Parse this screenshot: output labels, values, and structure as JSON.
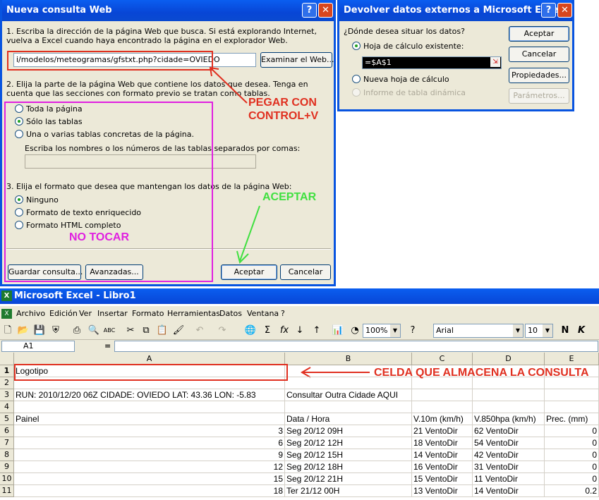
{
  "dialog1": {
    "title": "Nueva consulta Web",
    "step1": "1. Escriba la dirección de la página Web que busca. Si está explorando Internet, vuelva a Excel cuando haya encontrado la página en el explorador Web.",
    "url": "i/modelos/meteogramas/gfstxt.php?cidade=OVIEDO",
    "browse": "Examinar el Web...",
    "step2": "2. Elija la parte de la página Web que contiene los datos que desea. Tenga en cuenta que las secciones con formato previo se tratan como tablas.",
    "opt_all": "Toda la página",
    "opt_tables": "Sólo las tablas",
    "opt_some": "Una o varias tablas concretas de la página.",
    "names_label": "Escriba los nombres o los números de las tablas separados por comas:",
    "step3": "3. Elija el formato que desea que mantengan los datos de la página Web:",
    "fmt_none": "Ninguno",
    "fmt_rich": "Formato de texto enriquecido",
    "fmt_html": "Formato HTML completo",
    "save": "Guardar consulta...",
    "advanced": "Avanzadas...",
    "ok": "Aceptar",
    "cancel": "Cancelar"
  },
  "dialog2": {
    "title": "Devolver datos externos a Microsoft Excel",
    "question": "¿Dónde desea situar los datos?",
    "opt_existing": "Hoja de cálculo existente:",
    "ref": "=$A$1",
    "opt_new": "Nueva hoja de cálculo",
    "opt_pivot": "Informe de tabla dinámica",
    "ok": "Aceptar",
    "cancel": "Cancelar",
    "props": "Propiedades...",
    "params": "Parámetros..."
  },
  "annotations": {
    "paste": "PEGAR CON",
    "paste2": "CONTROL+V",
    "accept": "ACEPTAR",
    "notouch": "NO TOCAR",
    "cell": "CELDA QUE ALMACENA LA CONSULTA",
    "color_red": "#e03020",
    "color_magenta": "#e020e0",
    "color_green": "#40e040"
  },
  "excel": {
    "title": "Microsoft Excel - Libro1",
    "menu": [
      "Archivo",
      "Edición",
      "Ver",
      "Insertar",
      "Formato",
      "Herramientas",
      "Datos",
      "Ventana",
      "?"
    ],
    "zoom": "100%",
    "font": "Arial",
    "size": "10",
    "namebox": "A1",
    "fx": "=",
    "columns": [
      "A",
      "B",
      "C",
      "D",
      "E"
    ],
    "rows": [
      {
        "n": "1",
        "a": "Logotipo",
        "b": "",
        "c": "",
        "d": "",
        "e": ""
      },
      {
        "n": "2",
        "a": "",
        "b": "",
        "c": "",
        "d": "",
        "e": ""
      },
      {
        "n": "3",
        "a": "RUN: 2010/12/20 06Z CIDADE:  OVIEDO LAT: 43.36 LON: -5.83",
        "b": "Consultar Outra Cidade AQUI",
        "c": "",
        "d": "",
        "e": ""
      },
      {
        "n": "4",
        "a": "",
        "b": "",
        "c": "",
        "d": "",
        "e": ""
      },
      {
        "n": "5",
        "a": "Painel",
        "b": "Data / Hora",
        "c": "V.10m (km/h)",
        "d": "V.850hpa (km/h)",
        "e": "Prec. (mm)"
      },
      {
        "n": "6",
        "a": "3",
        "b": "Seg 20/12 09H",
        "c": "21 VentoDir",
        "d": "62 VentoDir",
        "e": "0"
      },
      {
        "n": "7",
        "a": "6",
        "b": "Seg 20/12 12H",
        "c": "18 VentoDir",
        "d": "54 VentoDir",
        "e": "0"
      },
      {
        "n": "8",
        "a": "9",
        "b": "Seg 20/12 15H",
        "c": "14 VentoDir",
        "d": "42 VentoDir",
        "e": "0"
      },
      {
        "n": "9",
        "a": "12",
        "b": "Seg 20/12 18H",
        "c": "16 VentoDir",
        "d": "31 VentoDir",
        "e": "0"
      },
      {
        "n": "10",
        "a": "15",
        "b": "Seg 20/12 21H",
        "c": "15 VentoDir",
        "d": "11 VentoDir",
        "e": "0"
      },
      {
        "n": "11",
        "a": "18",
        "b": "Ter 21/12 00H",
        "c": "13 VentoDir",
        "d": "14 VentoDir",
        "e": "0.2"
      }
    ]
  }
}
